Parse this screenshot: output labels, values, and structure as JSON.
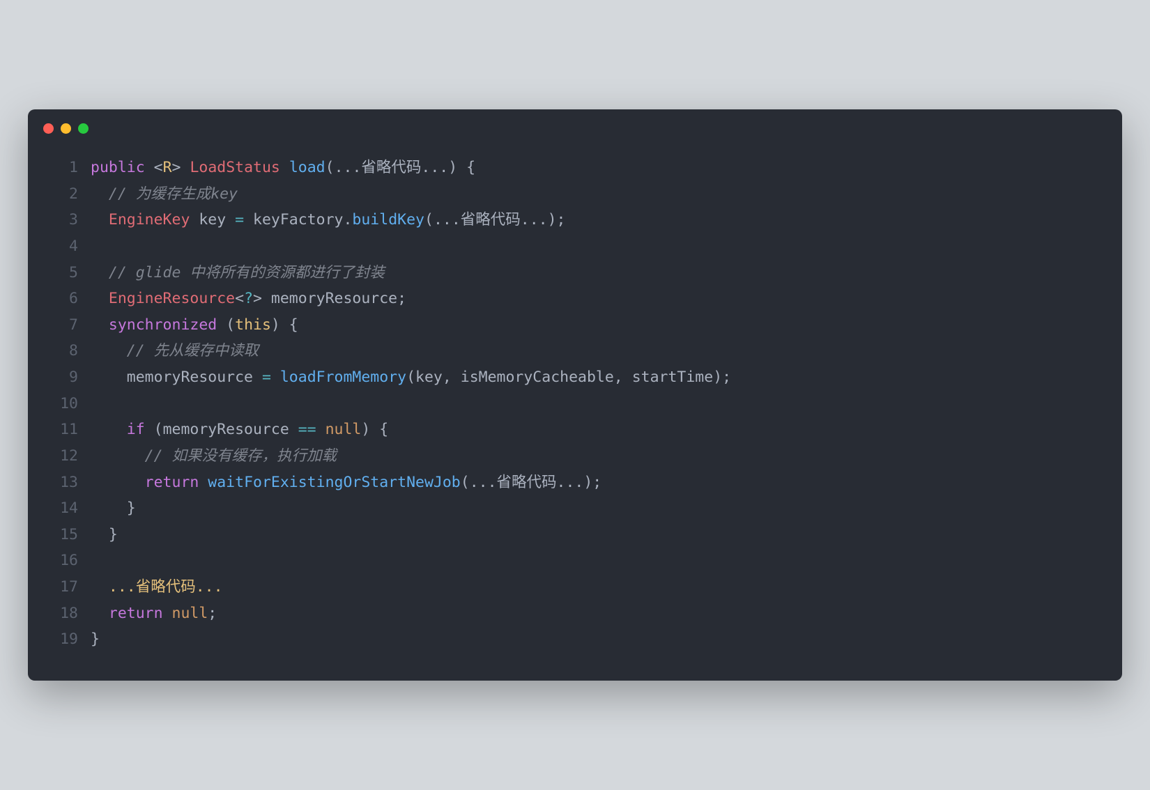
{
  "window": {
    "dots": [
      "red",
      "yellow",
      "green"
    ]
  },
  "code": {
    "lines": [
      {
        "num": "1",
        "tokens": [
          {
            "t": "public",
            "c": "tok-keyword"
          },
          {
            "t": " ",
            "c": "tok-plain"
          },
          {
            "t": "<",
            "c": "tok-punct"
          },
          {
            "t": "R",
            "c": "tok-string"
          },
          {
            "t": ">",
            "c": "tok-punct"
          },
          {
            "t": " ",
            "c": "tok-plain"
          },
          {
            "t": "LoadStatus",
            "c": "tok-type"
          },
          {
            "t": " ",
            "c": "tok-plain"
          },
          {
            "t": "load",
            "c": "tok-method"
          },
          {
            "t": "(",
            "c": "tok-punct"
          },
          {
            "t": "...省略代码...",
            "c": "tok-plain"
          },
          {
            "t": ")",
            "c": "tok-punct"
          },
          {
            "t": " {",
            "c": "tok-punct"
          }
        ]
      },
      {
        "num": "2",
        "tokens": [
          {
            "t": "  ",
            "c": "tok-plain"
          },
          {
            "t": "// 为缓存生成key",
            "c": "tok-comment"
          }
        ]
      },
      {
        "num": "3",
        "tokens": [
          {
            "t": "  ",
            "c": "tok-plain"
          },
          {
            "t": "EngineKey",
            "c": "tok-type"
          },
          {
            "t": " key ",
            "c": "tok-plain"
          },
          {
            "t": "=",
            "c": "tok-operator"
          },
          {
            "t": " keyFactory.",
            "c": "tok-plain"
          },
          {
            "t": "buildKey",
            "c": "tok-method"
          },
          {
            "t": "(",
            "c": "tok-punct"
          },
          {
            "t": "...省略代码...",
            "c": "tok-plain"
          },
          {
            "t": ");",
            "c": "tok-punct"
          }
        ]
      },
      {
        "num": "4",
        "tokens": []
      },
      {
        "num": "5",
        "tokens": [
          {
            "t": "  ",
            "c": "tok-plain"
          },
          {
            "t": "// glide 中将所有的资源都进行了封装",
            "c": "tok-comment"
          }
        ]
      },
      {
        "num": "6",
        "tokens": [
          {
            "t": "  ",
            "c": "tok-plain"
          },
          {
            "t": "EngineResource",
            "c": "tok-type"
          },
          {
            "t": "<",
            "c": "tok-punct"
          },
          {
            "t": "?",
            "c": "tok-operator"
          },
          {
            "t": ">",
            "c": "tok-punct"
          },
          {
            "t": " memoryResource;",
            "c": "tok-plain"
          }
        ]
      },
      {
        "num": "7",
        "tokens": [
          {
            "t": "  ",
            "c": "tok-plain"
          },
          {
            "t": "synchronized",
            "c": "tok-keyword"
          },
          {
            "t": " (",
            "c": "tok-punct"
          },
          {
            "t": "this",
            "c": "tok-this"
          },
          {
            "t": ") {",
            "c": "tok-punct"
          }
        ]
      },
      {
        "num": "8",
        "tokens": [
          {
            "t": "    ",
            "c": "tok-plain"
          },
          {
            "t": "// 先从缓存中读取",
            "c": "tok-comment"
          }
        ]
      },
      {
        "num": "9",
        "tokens": [
          {
            "t": "    memoryResource ",
            "c": "tok-plain"
          },
          {
            "t": "=",
            "c": "tok-operator"
          },
          {
            "t": " ",
            "c": "tok-plain"
          },
          {
            "t": "loadFromMemory",
            "c": "tok-method"
          },
          {
            "t": "(",
            "c": "tok-punct"
          },
          {
            "t": "key, isMemoryCacheable, startTime",
            "c": "tok-plain"
          },
          {
            "t": ");",
            "c": "tok-punct"
          }
        ]
      },
      {
        "num": "10",
        "tokens": []
      },
      {
        "num": "11",
        "tokens": [
          {
            "t": "    ",
            "c": "tok-plain"
          },
          {
            "t": "if",
            "c": "tok-keyword"
          },
          {
            "t": " (",
            "c": "tok-punct"
          },
          {
            "t": "memoryResource ",
            "c": "tok-plain"
          },
          {
            "t": "==",
            "c": "tok-operator"
          },
          {
            "t": " ",
            "c": "tok-plain"
          },
          {
            "t": "null",
            "c": "tok-null"
          },
          {
            "t": ") {",
            "c": "tok-punct"
          }
        ]
      },
      {
        "num": "12",
        "tokens": [
          {
            "t": "      ",
            "c": "tok-plain"
          },
          {
            "t": "// 如果没有缓存，执行加载",
            "c": "tok-comment"
          }
        ]
      },
      {
        "num": "13",
        "tokens": [
          {
            "t": "      ",
            "c": "tok-plain"
          },
          {
            "t": "return",
            "c": "tok-keyword"
          },
          {
            "t": " ",
            "c": "tok-plain"
          },
          {
            "t": "waitForExistingOrStartNewJob",
            "c": "tok-method"
          },
          {
            "t": "(",
            "c": "tok-punct"
          },
          {
            "t": "...省略代码...",
            "c": "tok-plain"
          },
          {
            "t": ");",
            "c": "tok-punct"
          }
        ]
      },
      {
        "num": "14",
        "tokens": [
          {
            "t": "    }",
            "c": "tok-punct"
          }
        ]
      },
      {
        "num": "15",
        "tokens": [
          {
            "t": "  }",
            "c": "tok-punct"
          }
        ]
      },
      {
        "num": "16",
        "tokens": []
      },
      {
        "num": "17",
        "tokens": [
          {
            "t": "  ",
            "c": "tok-plain"
          },
          {
            "t": "...省略代码...",
            "c": "tok-string"
          }
        ]
      },
      {
        "num": "18",
        "tokens": [
          {
            "t": "  ",
            "c": "tok-plain"
          },
          {
            "t": "return",
            "c": "tok-keyword"
          },
          {
            "t": " ",
            "c": "tok-plain"
          },
          {
            "t": "null",
            "c": "tok-null"
          },
          {
            "t": ";",
            "c": "tok-punct"
          }
        ]
      },
      {
        "num": "19",
        "tokens": [
          {
            "t": "}",
            "c": "tok-punct"
          }
        ]
      }
    ]
  }
}
